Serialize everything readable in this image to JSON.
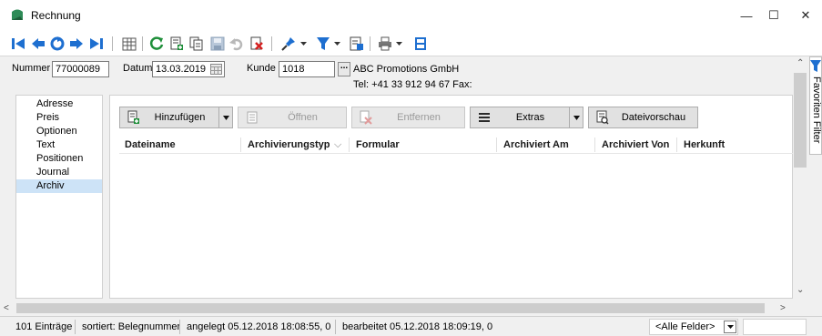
{
  "window": {
    "title": "Rechnung",
    "minimize": "—",
    "maximize": "☐",
    "close": "✕"
  },
  "header": {
    "nummer_label": "Nummer",
    "nummer_value": "77000089",
    "datum_label": "Datum",
    "datum_value": "13.03.2019",
    "kunde_label": "Kunde",
    "kunde_value": "1018",
    "ellipsis": "...",
    "company": "ABC Promotions GmbH",
    "contact": "Tel: +41 33 912 94 67  Fax:"
  },
  "nav": {
    "items": [
      "Adresse",
      "Preis",
      "Optionen",
      "Text",
      "Positionen",
      "Journal",
      "Archiv"
    ],
    "selected": "Archiv"
  },
  "actions": {
    "add": "Hinzufügen",
    "open": "Öffnen",
    "remove": "Entfernen",
    "extras": "Extras",
    "preview": "Dateivorschau"
  },
  "table": {
    "columns": [
      "Dateiname",
      "Archivierungstyp",
      "Formular",
      "Archiviert Am",
      "Archiviert Von",
      "Herkunft"
    ],
    "sort_indicator": "⌵"
  },
  "sidepanel": {
    "label": "Favoriten Filter"
  },
  "statusbar": {
    "count": "101 Einträge",
    "sort": "sortiert: Belegnummer",
    "created": "angelegt 05.12.2018 18:08:55,  0",
    "edited": "bearbeitet 05.12.2018 18:09:19,  0",
    "filter_select": "<Alle Felder>"
  },
  "colors": {
    "accent_blue": "#1e6fd0",
    "green": "#1f8f3a",
    "selected": "#cde3f7"
  },
  "icons": [
    "first-record-icon",
    "previous-record-icon",
    "refresh-icon",
    "next-record-icon",
    "last-record-icon",
    "table-view-icon",
    "reload-icon",
    "new-icon",
    "copy-icon",
    "save-icon",
    "undo-icon",
    "delete-icon",
    "pin-icon",
    "filter-icon",
    "report-icon",
    "print-icon",
    "calculator-icon"
  ]
}
